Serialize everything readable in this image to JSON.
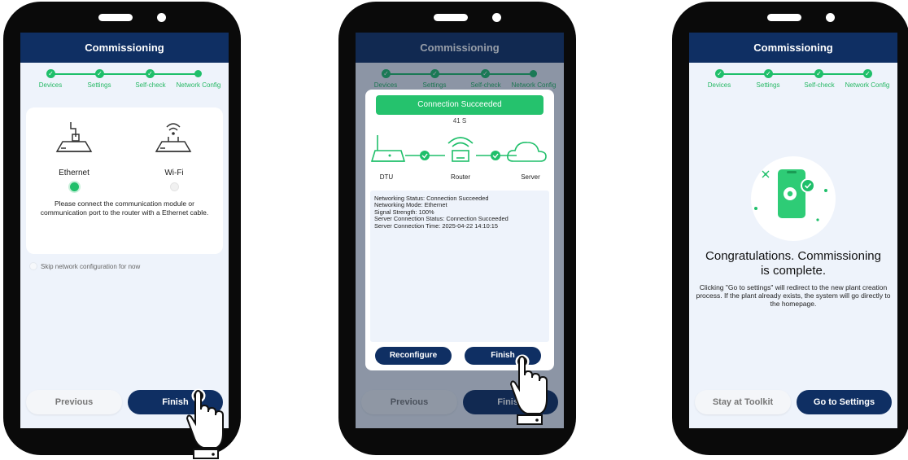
{
  "phone1": {
    "title": "Commissioning",
    "steps": [
      "Devices",
      "Settings",
      "Self-check",
      "Network Config"
    ],
    "option_ethernet": "Ethernet",
    "option_wifi": "Wi-Fi",
    "instruction": "Please connect the communication module or communication port to the router with a Ethernet cable.",
    "skip_label": "Skip network configuration for now",
    "previous_label": "Previous",
    "finish_label": "Finish"
  },
  "phone2": {
    "title": "Commissioning",
    "steps": [
      "Devices",
      "Settings",
      "Self-check",
      "Network Config"
    ],
    "banner": "Connection Succeeded",
    "timer": "41 S",
    "nodes": [
      "DTU",
      "Router",
      "Server"
    ],
    "status_lines": [
      "Networking Status: Connection Succeeded",
      "Networking Mode: Ethernet",
      "Signal Strength: 100%",
      "Server Connection Status: Connection Succeeded",
      "Server Connection Time: 2025-04-22 14:10:15"
    ],
    "reconfigure_label": "Reconfigure",
    "finish_label": "Finish",
    "bg_previous_label": "Previous",
    "bg_finish_label": "Finish"
  },
  "phone3": {
    "title": "Commissioning",
    "steps": [
      "Devices",
      "Settings",
      "Self-check",
      "Network Config"
    ],
    "headline_line1": "Congratulations. Commissioning",
    "headline_line2": "is complete.",
    "message": "Clicking \"Go to settings\" will redirect to the new plant creation process. If the plant already exists, the system will go directly to the homepage.",
    "stay_label": "Stay at Toolkit",
    "settings_label": "Go to Settings"
  },
  "colors": {
    "navy": "#0f2f63",
    "green": "#1fbf6a",
    "screen_bg": "#eef3fb"
  }
}
